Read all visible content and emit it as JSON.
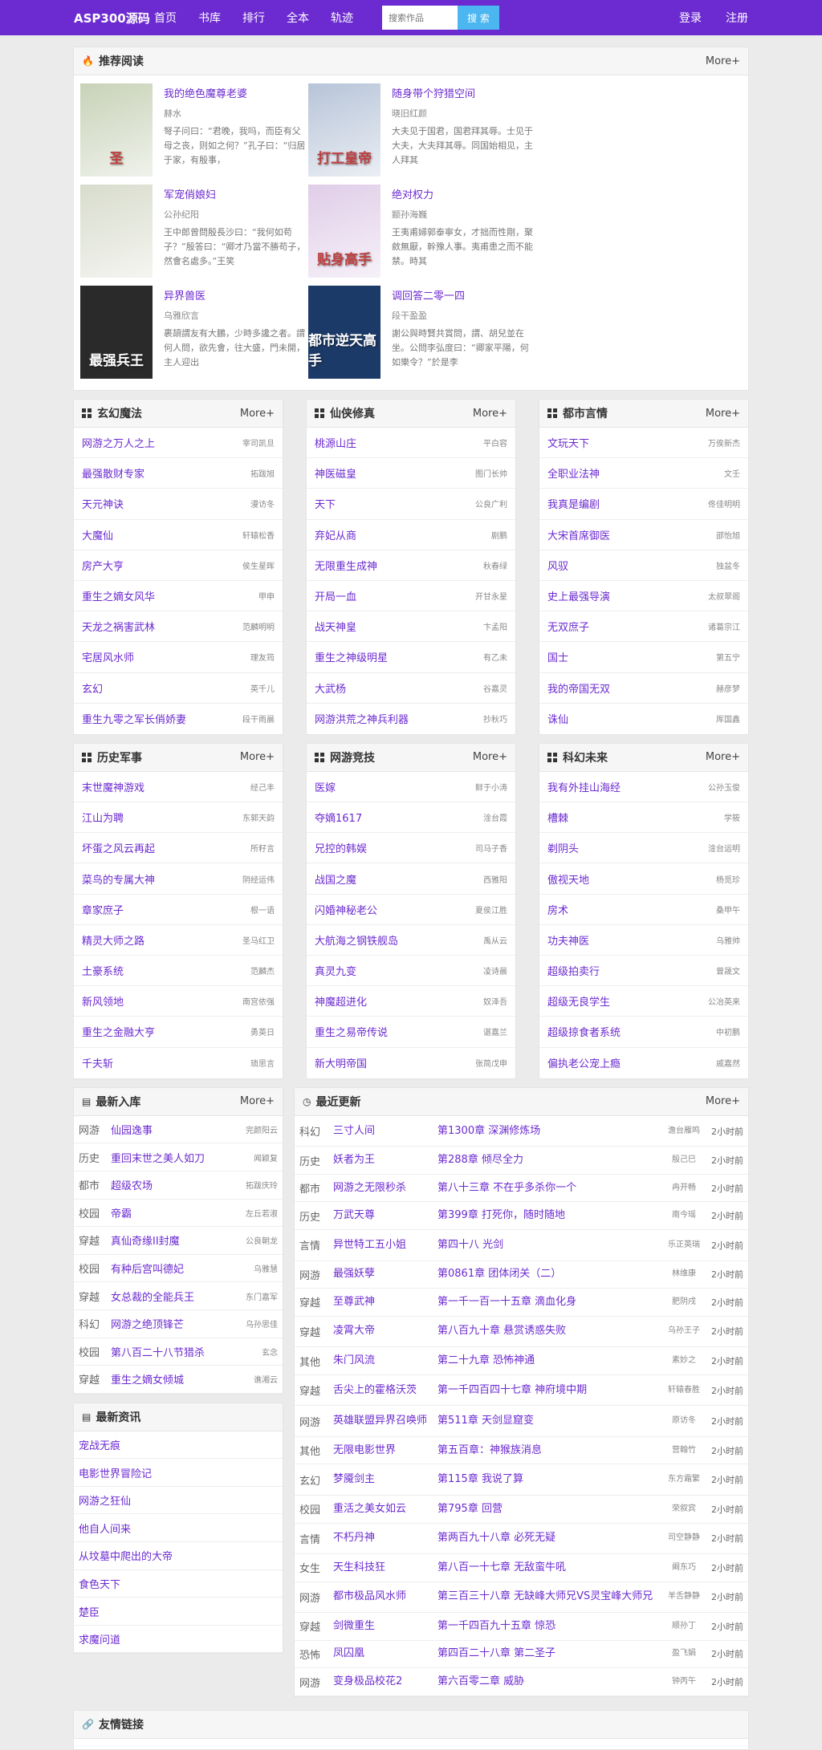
{
  "header": {
    "logo": "ASP300源码",
    "nav": [
      "首页",
      "书库",
      "排行",
      "全本",
      "轨迹"
    ],
    "search_placeholder": "搜索作品",
    "search_button": "搜 索",
    "login": "登录",
    "register": "注册"
  },
  "recommend": {
    "title": "推荐阅读",
    "more": "More+",
    "books": [
      {
        "title": "我的绝色魔尊老婆",
        "author": "赫水",
        "desc": "弩子问曰：“君晚，我吗，而臣有父母之丧，则如之何？”孔子曰：“归居于家，有殷事，",
        "cover": "#c8d2b8",
        "cover_text": "圣"
      },
      {
        "title": "随身带个狩猎空间",
        "author": "晓旧红颜",
        "desc": "大夫见于国君，国君拜其辱。士见于大夫，大夫拜其辱。同国始相见，主人拜其",
        "cover": "#b7c4d8",
        "cover_text": "打工皇帝"
      },
      {
        "title": "军宠俏娘妇",
        "author": "公孙纪阳",
        "desc": "王中郎曾問殷長沙曰：“我何如苟子？”殷答曰：“卿才乃當不勝苟子，然會名處多。”王笑",
        "cover": "#d8dccc",
        "cover_text": ""
      },
      {
        "title": "绝对权力",
        "author": "颛孙海巍",
        "desc": "王夷甫婦郭泰寧女，才拙而性剛，聚斂無厭，幹豫人事。夷甫患之而不能禁。時其",
        "cover": "#e0cde8",
        "cover_text": "贴身高手"
      },
      {
        "title": "异界兽医",
        "author": "乌雅欣言",
        "desc": "裹頡謂友有大鵬，少時多讒之者。謂何人問，欲先會，往大盛，門未開，主人迎出",
        "cover": "#2a2a2a",
        "cover_text": "最强兵王"
      },
      {
        "title": "调回答二零一四",
        "author": "段干盈盈",
        "desc": "謝公與時賢共賞問，謂、胡兒並在坐。公問李弘度曰：“卿家平陽，何如樂令？”於是李",
        "cover": "#1c3a68",
        "cover_text": "都市逆天高手"
      }
    ]
  },
  "cat1": [
    {
      "title": "玄幻魔法",
      "more": "More+",
      "items": [
        [
          "网游之万人之上",
          "宰司凯旦"
        ],
        [
          "最强散财专家",
          "拓跋旭"
        ],
        [
          "天元神诀",
          "漫访冬"
        ],
        [
          "大魔仙",
          "轩辕松香"
        ],
        [
          "房产大亨",
          "侯生星晖"
        ],
        [
          "重生之嫡女风华",
          "甲申"
        ],
        [
          "天龙之祸害武林",
          "范麟明明"
        ],
        [
          "宅居风水师",
          "理友筠"
        ],
        [
          "玄幻",
          "英千儿"
        ],
        [
          "重生九零之军长俏娇妻",
          "段干雨晨"
        ]
      ]
    },
    {
      "title": "仙侠修真",
      "more": "More+",
      "items": [
        [
          "桃源山庄",
          "平白容"
        ],
        [
          "神医磁皇",
          "图门长帅"
        ],
        [
          "天下",
          "公良广利"
        ],
        [
          "弃妃从商",
          "剧鹏"
        ],
        [
          "无限重生成神",
          "秋春绿"
        ],
        [
          "开局一血",
          "开甘永星"
        ],
        [
          "战天神皇",
          "卞孟阳"
        ],
        [
          "重生之神级明星",
          "有乙未"
        ],
        [
          "大武杨",
          "谷嘉灵"
        ],
        [
          "网游洪荒之神兵利器",
          "抄秋巧"
        ]
      ]
    },
    {
      "title": "都市言情",
      "more": "More+",
      "items": [
        [
          "文玩天下",
          "万俟新杰"
        ],
        [
          "全职业法神",
          "文壬"
        ],
        [
          "我真是编剧",
          "佟佳明明"
        ],
        [
          "大宋首席御医",
          "邵怡旭"
        ],
        [
          "风驭",
          "独盆冬"
        ],
        [
          "史上最强导演",
          "太叔翠阁"
        ],
        [
          "无双庶子",
          "诸葛宗江"
        ],
        [
          "国士",
          "第五宁"
        ],
        [
          "我的帝国无双",
          "赫彦梦"
        ],
        [
          "诛仙",
          "厍国鑫"
        ]
      ]
    }
  ],
  "cat2": [
    {
      "title": "历史军事",
      "more": "More+",
      "items": [
        [
          "末世魔神游戏",
          "经己丰"
        ],
        [
          "江山为聘",
          "东郭天韵"
        ],
        [
          "坏蛋之风云再起",
          "所籽言"
        ],
        [
          "菜鸟的专属大神",
          "阴经运伟"
        ],
        [
          "章家庶子",
          "根一语"
        ],
        [
          "精灵大师之路",
          "圣马红卫"
        ],
        [
          "土豪系统",
          "范麟杰"
        ],
        [
          "新风领地",
          "南宫依强"
        ],
        [
          "重生之金融大亨",
          "勇英日"
        ],
        [
          "千夫斩",
          "琐思言"
        ]
      ]
    },
    {
      "title": "网游竞技",
      "more": "More+",
      "items": [
        [
          "医嫁",
          "鲜于小涛"
        ],
        [
          "夺嫡1617",
          "淦台霞"
        ],
        [
          "兄控的韩娱",
          "司马子香"
        ],
        [
          "战国之魔",
          "西雅阳"
        ],
        [
          "闪婚神秘老公",
          "夏侯江胜"
        ],
        [
          "大航海之钢铁舰岛",
          "禹从云"
        ],
        [
          "真灵九变",
          "凌诗晨"
        ],
        [
          "神魔超进化",
          "奴泽吾"
        ],
        [
          "重生之易帝传说",
          "谌嘉兰"
        ],
        [
          "新大明帝国",
          "张简戊申"
        ]
      ]
    },
    {
      "title": "科幻未来",
      "more": "More+",
      "items": [
        [
          "我有外挂山海经",
          "公孙玉俊"
        ],
        [
          "槽棘",
          "学筱"
        ],
        [
          "剃阴头",
          "淦台运明"
        ],
        [
          "傲视天地",
          "杨觅珍"
        ],
        [
          "房术",
          "桑甲午"
        ],
        [
          "功夫神医",
          "乌雅帅"
        ],
        [
          "超级拍卖行",
          "曾晟文"
        ],
        [
          "超级无良学生",
          "公冶英来"
        ],
        [
          "超级掠食者系统",
          "中初鹏"
        ],
        [
          "偏执老公宠上瘾",
          "戚嘉然"
        ]
      ]
    }
  ],
  "latest": {
    "title": "最新入库",
    "more": "More+",
    "items": [
      [
        "网游",
        "仙园逸事",
        "完颜阳云"
      ],
      [
        "历史",
        "重回末世之美人如刀",
        "闻颖复"
      ],
      [
        "都市",
        "超级农场",
        "拓跋庆玲"
      ],
      [
        "校园",
        "帝霸",
        "左丘若淑"
      ],
      [
        "穿越",
        "真仙奇缘II封魔",
        "公良朝龙"
      ],
      [
        "校园",
        "有种后宫叫德妃",
        "乌雅慧"
      ],
      [
        "穿越",
        "女总裁的全能兵王",
        "东门嘉军"
      ],
      [
        "科幻",
        "网游之绝顶锋芒",
        "乌孙思佳"
      ],
      [
        "校园",
        "第八百二十八节猎杀",
        "玄念"
      ],
      [
        "穿越",
        "重生之嫡女倾城",
        "谯湘云"
      ]
    ]
  },
  "news": {
    "title": "最新资讯",
    "items": [
      "宠战无痕",
      "电影世界冒险记",
      "网游之狂仙",
      "他自人间来",
      "从坟墓中爬出的大帝",
      "食色天下",
      "楚臣",
      "求魔问道"
    ]
  },
  "updates": {
    "title": "最近更新",
    "more": "More+",
    "items": [
      [
        "科幻",
        "三寸人间",
        "第1300章 深渊修炼场",
        "澹台雁鸣",
        "2小时前",
        2
      ],
      [
        "历史",
        "妖者为王",
        "第288章 倾尽全力",
        "殷己巳",
        "2小时前",
        1
      ],
      [
        "都市",
        "网游之无限秒杀",
        "第八十三章 不在乎多杀你一个",
        "冉开畅",
        "2小时前",
        1
      ],
      [
        "历史",
        "万武天尊",
        "第399章 打死你，随时随地",
        "南今瑶",
        "2小时前",
        1
      ],
      [
        "言情",
        "异世特工五小姐",
        "第四十八 光剑",
        "乐正英瑞",
        "2小时前",
        2
      ],
      [
        "网游",
        "最强妖孽",
        "第0861章 团体闭关（二）",
        "林维康",
        "2小时前",
        1
      ],
      [
        "穿越",
        "至尊武神",
        "第一千一百一十五章 滴血化身",
        "肥阴戌",
        "2小时前",
        1
      ],
      [
        "穿越",
        "凌霄大帝",
        "第八百九十章 悬赏诱惑失败",
        "乌孙王子",
        "2小时前",
        2
      ],
      [
        "其他",
        "朱门风流",
        "第二十九章 恐怖神通",
        "素妙之",
        "2小时前",
        1
      ],
      [
        "穿越",
        "舌尖上的霍格沃茨",
        "第一千四百四十七章 神府境中期",
        "轩辕春胜",
        "2小时前",
        2
      ],
      [
        "网游",
        "英雄联盟异界召唤师",
        "第511章 天剑显窟变",
        "原访冬",
        "2小时前",
        2
      ],
      [
        "其他",
        "无限电影世界",
        "第五百章：神猴族消息",
        "营翰竹",
        "2小时前",
        1
      ],
      [
        "玄幻",
        "梦魇剑主",
        "第115章 我说了算",
        "东方霜繁",
        "2小时前",
        2
      ],
      [
        "校园",
        "重活之美女如云",
        "第795章 回营",
        "荣叙宾",
        "2小时前",
        1
      ],
      [
        "言情",
        "不朽丹神",
        "第两百九十八章 必死无疑",
        "司空静静",
        "2小时前",
        2
      ],
      [
        "女生",
        "天生科技狂",
        "第八百一十七章 无敌蛮牛吼",
        "阚东巧",
        "2小时前",
        1
      ],
      [
        "网游",
        "都市极品风水师",
        "第三百三十八章 无缺峰大师兄VS灵宝峰大师兄",
        "羊舌静静",
        "2小时前",
        2
      ],
      [
        "穿越",
        "剑微重生",
        "第一千四百九十五章 惊恐",
        "顺孙丁",
        "2小时前",
        1
      ],
      [
        "恐怖",
        "凤囚凰",
        "第四百二十八章 第二圣子",
        "盈飞娟",
        "2小时前",
        1
      ],
      [
        "网游",
        "变身极品校花2",
        "第六百零二章 威胁",
        "钟丙午",
        "2小时前",
        1
      ]
    ]
  },
  "friend_links": {
    "title": "友情链接"
  },
  "colors": {
    "accent": "#6c2bd0",
    "search_button": "#4cb6f0"
  },
  "icons": {
    "recommend": "fire-icon",
    "category": "grid-icon",
    "latest": "list-icon",
    "updates": "clock-icon",
    "links": "link-icon"
  }
}
